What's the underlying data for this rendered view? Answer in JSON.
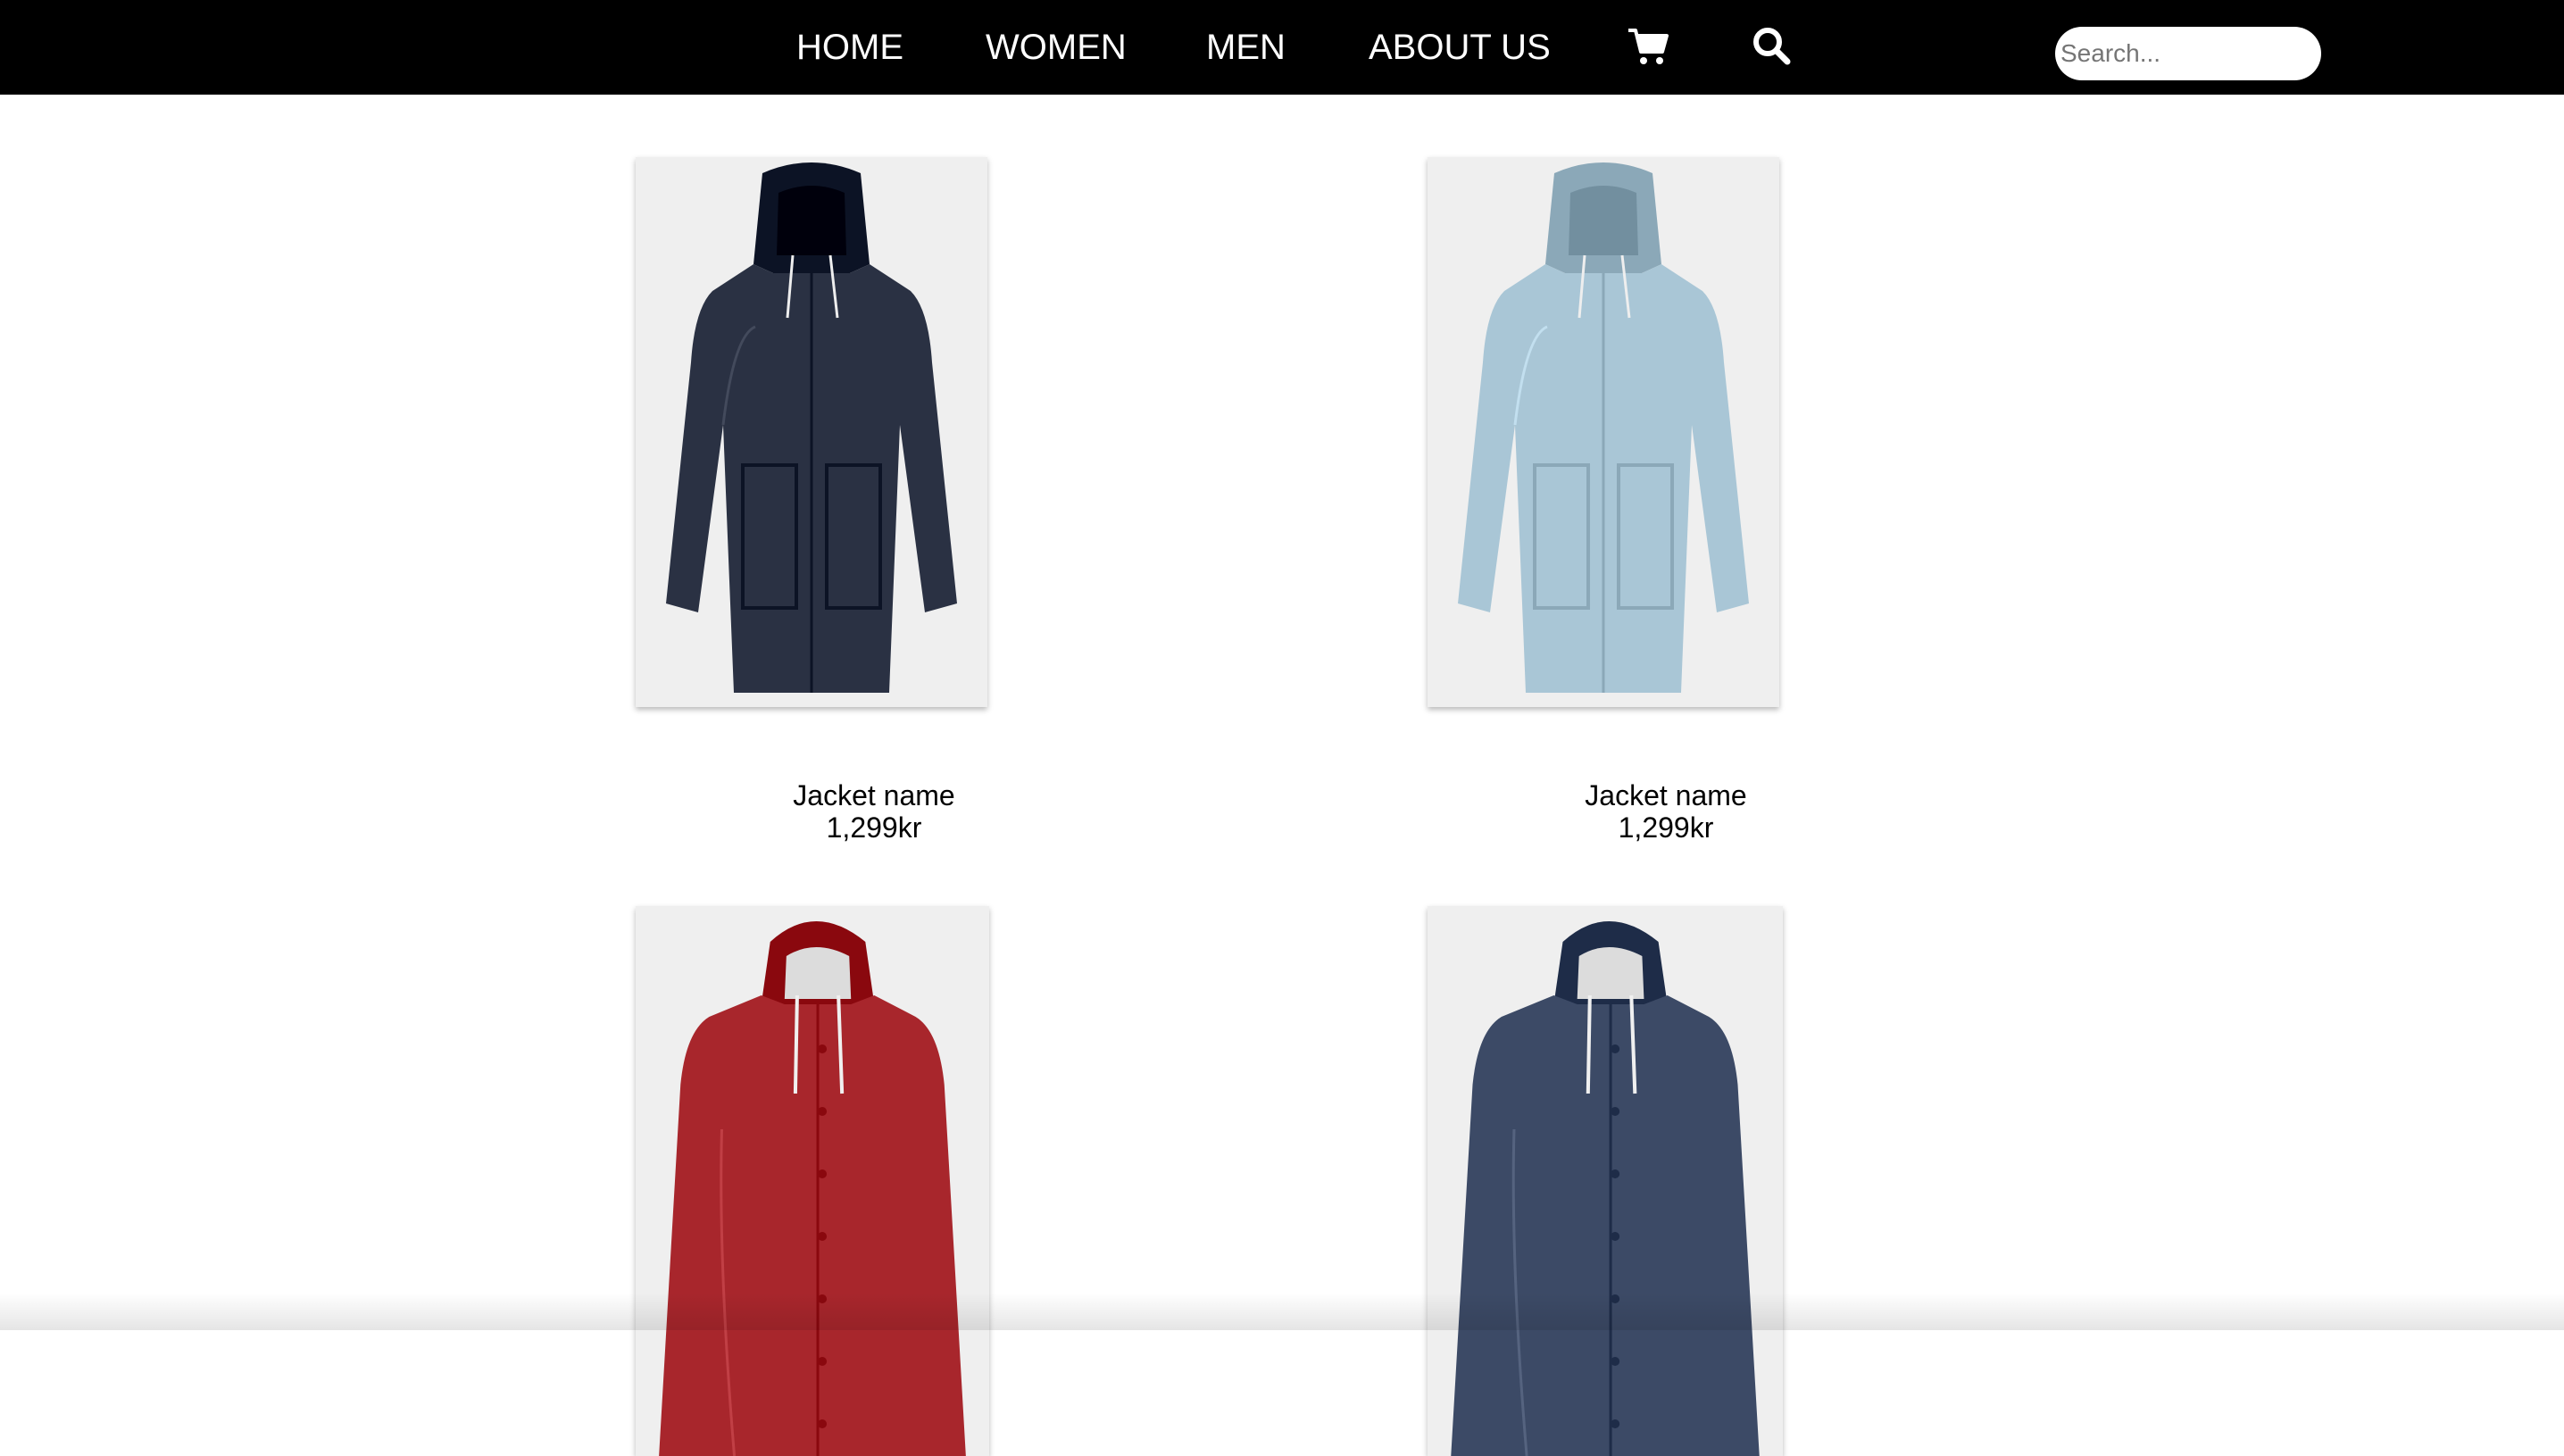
{
  "nav": {
    "items": [
      {
        "label": "HOME"
      },
      {
        "label": "WOMEN"
      },
      {
        "label": "MEN"
      },
      {
        "label": "ABOUT US"
      }
    ],
    "cart_icon": "shopping-cart-icon",
    "search_icon": "magnifier-icon",
    "search_placeholder": "Search..."
  },
  "products": [
    {
      "name": "Jacket name",
      "price": "1,299kr",
      "color": "#2a3143",
      "style": "parka"
    },
    {
      "name": "Jacket name",
      "price": "1,299kr",
      "color": "#a9c6d6",
      "style": "parka"
    },
    {
      "name": "",
      "price": "",
      "color": "#a8262c",
      "style": "raincoat"
    },
    {
      "name": "",
      "price": "",
      "color": "#3c4a66",
      "style": "raincoat"
    }
  ],
  "colors": {
    "nav_background": "#000000",
    "nav_text": "#ffffff",
    "page_background": "#ffffff",
    "photo_background": "#efefef"
  }
}
